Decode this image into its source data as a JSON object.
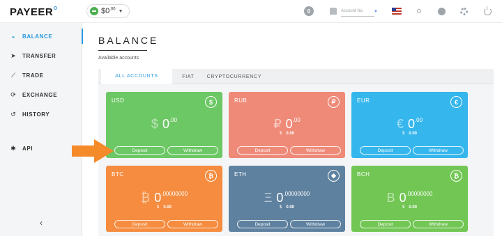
{
  "header": {
    "logo_text": "PAYEER",
    "balance": {
      "amount": "$0",
      "cents": ".00"
    },
    "notifications_count": "0",
    "account_label": "Account No."
  },
  "sidebar": {
    "items": [
      {
        "label": "BALANCE",
        "icon": "gauge-icon",
        "active": true
      },
      {
        "label": "TRANSFER",
        "icon": "paper-plane-icon",
        "active": false
      },
      {
        "label": "TRADE",
        "icon": "line-chart-icon",
        "active": false
      },
      {
        "label": "EXCHANGE",
        "icon": "exchange-icon",
        "active": false
      },
      {
        "label": "HISTORY",
        "icon": "history-icon",
        "active": false
      },
      {
        "label": "API",
        "icon": "gears-icon",
        "active": false
      }
    ],
    "collapse_glyph": "‹"
  },
  "main": {
    "title": "BALANCE",
    "subtitle": "Available accounts",
    "tabs": [
      {
        "label": "ALL ACCOUNTS",
        "active": true
      },
      {
        "label": "FIAT",
        "active": false
      },
      {
        "label": "CRYPTOCURRENCY",
        "active": false
      }
    ]
  },
  "cards": [
    {
      "code": "USD",
      "badge": "$",
      "symbol": "$",
      "int": "0",
      "frac": ".00",
      "usd_symbol": "",
      "usd_value": "",
      "color": "#6cc765",
      "deposit": "Deposit",
      "withdraw": "Withdraw"
    },
    {
      "code": "RUB",
      "badge": "₽",
      "symbol": "₽",
      "int": "0",
      "frac": ".00",
      "usd_symbol": "$",
      "usd_value": "0.00",
      "color": "#ef8a78",
      "deposit": "Deposit",
      "withdraw": "Withdraw"
    },
    {
      "code": "EUR",
      "badge": "€",
      "symbol": "€",
      "int": "0",
      "frac": ".00",
      "usd_symbol": "$",
      "usd_value": "0.00",
      "color": "#35b6ec",
      "deposit": "Deposit",
      "withdraw": "Withdraw"
    },
    {
      "code": "BTC",
      "badge": "₿",
      "symbol": "₿",
      "int": "0",
      "frac": ".00000000",
      "usd_symbol": "$",
      "usd_value": "0.00",
      "color": "#f58c3f",
      "deposit": "Deposit",
      "withdraw": "Withdraw"
    },
    {
      "code": "ETH",
      "badge": "◆",
      "symbol": "Ξ",
      "int": "0",
      "frac": ".00000000",
      "usd_symbol": "$",
      "usd_value": "0.00",
      "color": "#5e819f",
      "deposit": "Deposit",
      "withdraw": "Withdraw"
    },
    {
      "code": "BCH",
      "badge": "₿",
      "symbol": "B",
      "int": "0",
      "frac": ".00000000",
      "usd_symbol": "$",
      "usd_value": "0.00",
      "color": "#72c654",
      "deposit": "Deposit",
      "withdraw": "Withdraw"
    }
  ],
  "colors": {
    "accent": "#2a9be0",
    "arrow": "#f58a2a"
  }
}
